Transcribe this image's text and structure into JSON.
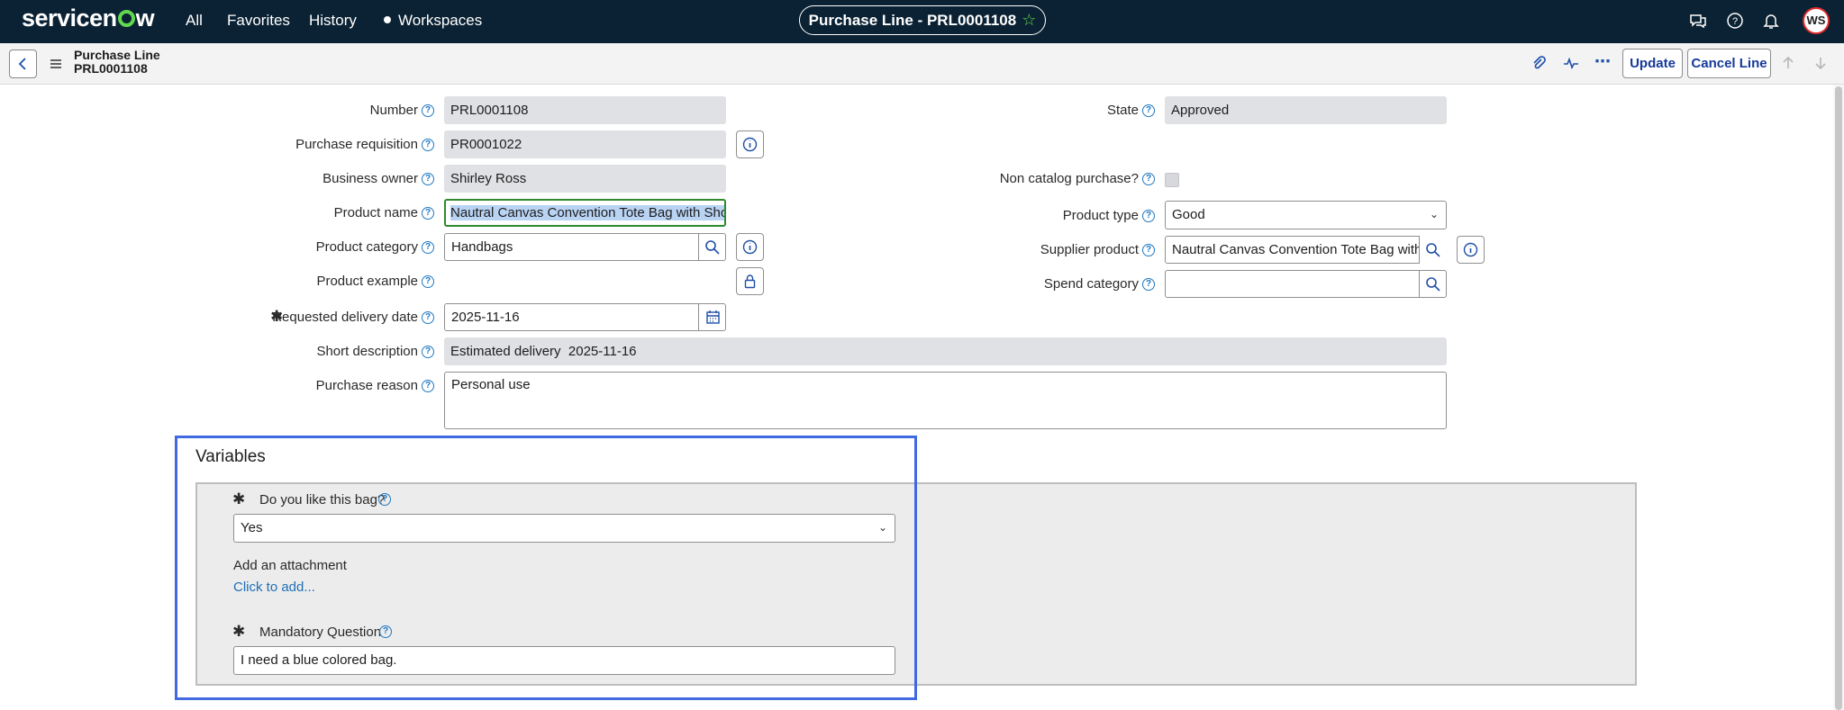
{
  "nav": {
    "logo_left": "servicen",
    "logo_right": "w",
    "all": "All",
    "favorites": "Favorites",
    "history": "History",
    "workspaces": "Workspaces",
    "record_pill": "Purchase Line - PRL0001108",
    "avatar_initials": "WS"
  },
  "header": {
    "title_line1": "Purchase Line",
    "title_line2": "PRL0001108",
    "update_label": "Update",
    "cancel_line_label": "Cancel Line",
    "more_label": "⋯"
  },
  "form": {
    "number_label": "Number",
    "number_value": "PRL0001108",
    "purchase_requisition_label": "Purchase requisition",
    "purchase_requisition_value": "PR0001022",
    "business_owner_label": "Business owner",
    "business_owner_value": "Shirley Ross",
    "product_name_label": "Product name",
    "product_name_value": "Nautral Canvas Convention Tote Bag with Should",
    "product_category_label": "Product category",
    "product_category_value": "Handbags",
    "product_example_label": "Product example",
    "requested_delivery_label": "Requested delivery date",
    "requested_delivery_value": "2025-11-16",
    "short_description_label": "Short description",
    "short_description_value": "Estimated delivery  2025-11-16",
    "purchase_reason_label": "Purchase reason",
    "purchase_reason_value": "Personal use",
    "state_label": "State",
    "state_value": "Approved",
    "non_catalog_label": "Non catalog purchase?",
    "product_type_label": "Product type",
    "product_type_value": "Good",
    "supplier_product_label": "Supplier product",
    "supplier_product_value": "Nautral Canvas Convention Tote Bag with S",
    "spend_category_label": "Spend category",
    "spend_category_value": ""
  },
  "variables": {
    "title": "Variables",
    "q1_label": "Do you like this bag?",
    "q1_value": "Yes",
    "attachment_label": "Add an attachment",
    "attachment_link": "Click to add...",
    "q2_label": "Mandatory Question",
    "q2_value": "I need a blue colored bag."
  },
  "colors": {
    "nav_bg": "#0a2234",
    "accent_green": "#62d84e",
    "button_text": "#163a9a",
    "highlight_box": "#4169e1",
    "focus_border": "#2f8a2c"
  }
}
